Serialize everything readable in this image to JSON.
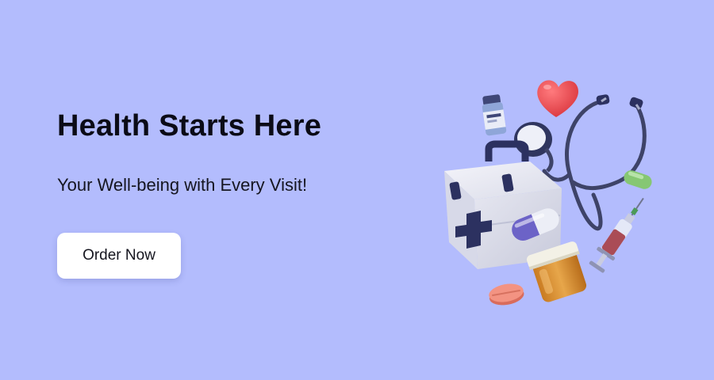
{
  "banner": {
    "headline": "Health Starts Here",
    "subline": "Your Well-being with Every Visit!",
    "cta_label": "Order Now"
  },
  "illustration": {
    "icons": [
      "medicine-vial-icon",
      "heart-icon",
      "stethoscope-icon",
      "first-aid-kit-icon",
      "capsule-icon",
      "syringe-icon",
      "pill-bottle-icon",
      "pill-tablet-icon",
      "green-pill-icon"
    ]
  },
  "colors": {
    "background": "#b3bcfd",
    "heading_text": "#0b0b16",
    "button_bg": "#ffffff",
    "accent_navy": "#2c3160",
    "heart_red": "#e8474c"
  }
}
